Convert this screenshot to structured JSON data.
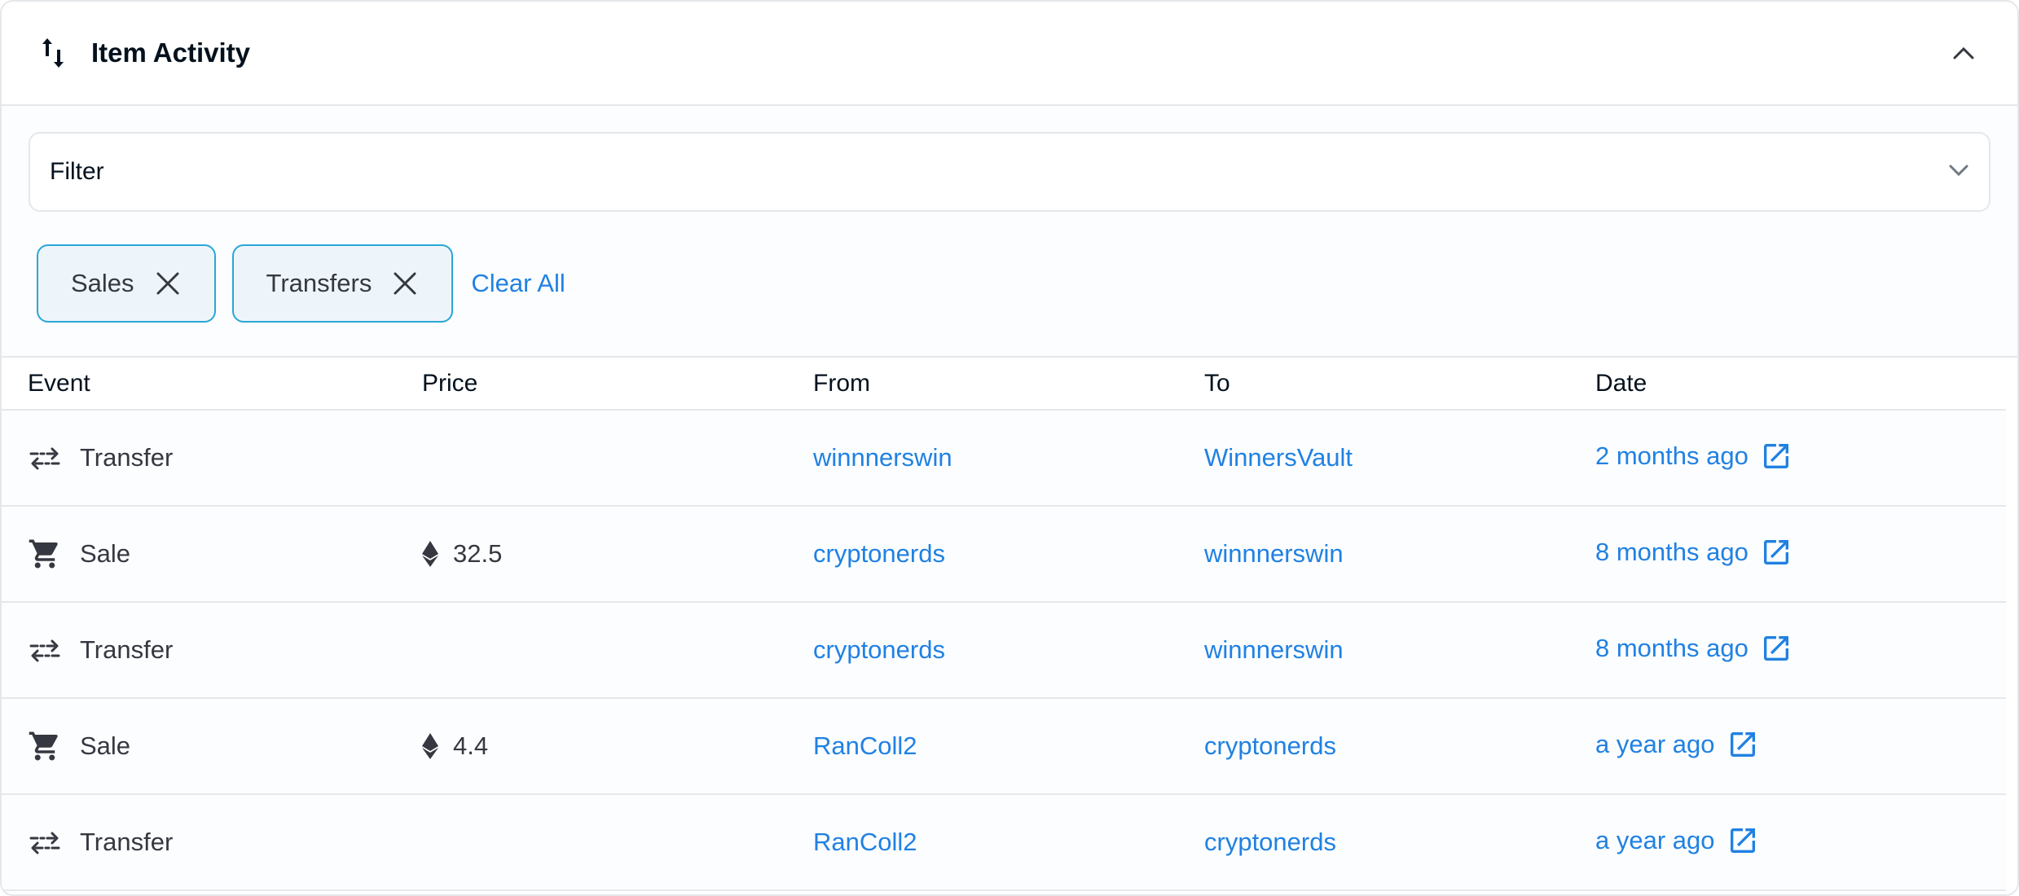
{
  "header": {
    "title": "Item Activity",
    "icon": "arrows-up-down-icon",
    "collapse_icon": "chevron-up-icon"
  },
  "filter": {
    "label": "Filter",
    "icon": "chevron-down-icon"
  },
  "chips": [
    {
      "label": "Sales",
      "icon": "close-icon"
    },
    {
      "label": "Transfers",
      "icon": "close-icon"
    }
  ],
  "clear_all": "Clear All",
  "table": {
    "headers": {
      "event": "Event",
      "price": "Price",
      "from": "From",
      "to": "To",
      "date": "Date"
    },
    "rows": [
      {
        "event": "Transfer",
        "event_icon": "transfer-icon",
        "price": "",
        "from": "winnnerswin",
        "to": "WinnersVault",
        "date": "2 months ago"
      },
      {
        "event": "Sale",
        "event_icon": "cart-icon",
        "price": "32.5",
        "from": "cryptonerds",
        "to": "winnnerswin",
        "date": "8 months ago"
      },
      {
        "event": "Transfer",
        "event_icon": "transfer-icon",
        "price": "",
        "from": "cryptonerds",
        "to": "winnnerswin",
        "date": "8 months ago"
      },
      {
        "event": "Sale",
        "event_icon": "cart-icon",
        "price": "4.4",
        "from": "RanColl2",
        "to": "cryptonerds",
        "date": "a year ago"
      },
      {
        "event": "Transfer",
        "event_icon": "transfer-icon",
        "price": "",
        "from": "RanColl2",
        "to": "cryptonerds",
        "date": "a year ago"
      }
    ]
  },
  "colors": {
    "link": "#2081e2",
    "chip_border": "#2aa7d6",
    "chip_bg": "#eef5fa",
    "border": "#e5e8eb"
  }
}
